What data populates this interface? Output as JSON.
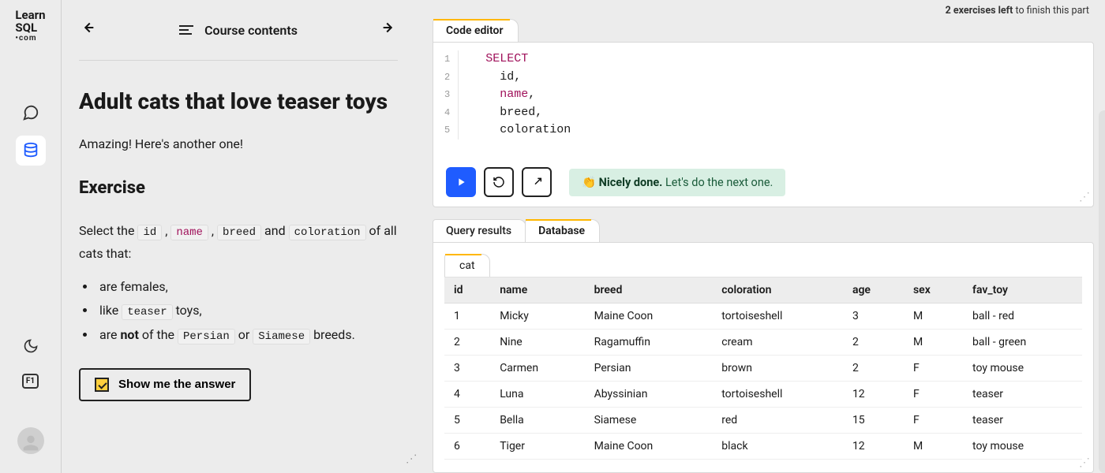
{
  "logo": {
    "line1": "Learn",
    "line2": "SQL",
    "line3": "•com"
  },
  "rail": {
    "chat_icon": "chat",
    "db_icon": "database",
    "moon_icon": "night-mode",
    "fi_icon": "F1"
  },
  "courseNav": {
    "label": "Course contents"
  },
  "page": {
    "title": "Adult cats that love teaser toys",
    "intro": "Amazing! Here's another one!",
    "exercise_h": "Exercise",
    "select_the": "Select the ",
    "and_word": " and ",
    "of_all": " of all cats that:",
    "chips": {
      "id": "id",
      "name": "name",
      "breed": "breed",
      "coloration": "coloration",
      "teaser": "teaser",
      "persian": "Persian",
      "siamese": "Siamese"
    },
    "bullets": {
      "b1": "are females,",
      "b2a": "like ",
      "b2b": " toys,",
      "b3a": "are ",
      "b3not": "not",
      "b3b": " of the ",
      "b3or": " or ",
      "b3c": " breeds."
    },
    "show_answer": "Show me the answer"
  },
  "topInfo": {
    "bold": "2 exercises left",
    "rest": " to finish this part"
  },
  "editorTab": "Code editor",
  "code": {
    "l1": "SELECT",
    "l2": "id,",
    "l3": "name",
    "l3b": ",",
    "l4": "breed,",
    "l5": "coloration"
  },
  "success": {
    "bold": "Nicely done.",
    "rest": " Let's do the next one."
  },
  "resultsTabs": {
    "query": "Query results",
    "database": "Database"
  },
  "innerTab": "cat",
  "table": {
    "headers": [
      "id",
      "name",
      "breed",
      "coloration",
      "age",
      "sex",
      "fav_toy"
    ],
    "rows": [
      [
        "1",
        "Micky",
        "Maine Coon",
        "tortoiseshell",
        "3",
        "M",
        "ball - red"
      ],
      [
        "2",
        "Nine",
        "Ragamuffin",
        "cream",
        "2",
        "M",
        "ball - green"
      ],
      [
        "3",
        "Carmen",
        "Persian",
        "brown",
        "2",
        "F",
        "toy mouse"
      ],
      [
        "4",
        "Luna",
        "Abyssinian",
        "tortoiseshell",
        "12",
        "F",
        "teaser"
      ],
      [
        "5",
        "Bella",
        "Siamese",
        "red",
        "15",
        "F",
        "teaser"
      ],
      [
        "6",
        "Tiger",
        "Maine Coon",
        "black",
        "12",
        "M",
        "toy mouse"
      ]
    ]
  }
}
